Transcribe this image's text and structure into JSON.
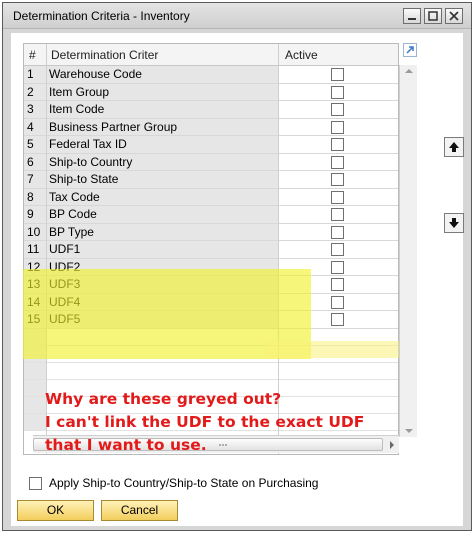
{
  "window": {
    "title": "Determination Criteria - Inventory"
  },
  "grid": {
    "headers": {
      "num": "#",
      "criteria": "Determination Criter",
      "active": "Active"
    },
    "rows": [
      {
        "num": "1",
        "name": "Warehouse Code"
      },
      {
        "num": "2",
        "name": "Item Group"
      },
      {
        "num": "3",
        "name": "Item Code"
      },
      {
        "num": "4",
        "name": "Business Partner Group"
      },
      {
        "num": "5",
        "name": "Federal Tax ID"
      },
      {
        "num": "6",
        "name": "Ship-to Country"
      },
      {
        "num": "7",
        "name": "Ship-to State"
      },
      {
        "num": "8",
        "name": "Tax Code"
      },
      {
        "num": "9",
        "name": "BP Code"
      },
      {
        "num": "10",
        "name": "BP Type"
      },
      {
        "num": "11",
        "name": "UDF1"
      },
      {
        "num": "12",
        "name": "UDF2"
      },
      {
        "num": "13",
        "name": "UDF3"
      },
      {
        "num": "14",
        "name": "UDF4"
      },
      {
        "num": "15",
        "name": "UDF5"
      }
    ]
  },
  "annotation": {
    "line1": "Why are these greyed out?",
    "line2": "I can't link the UDF to the exact UDF",
    "line3": "that I want to use."
  },
  "options": {
    "apply_ship_to": "Apply Ship-to Country/Ship-to State on Purchasing"
  },
  "buttons": {
    "ok": "OK",
    "cancel": "Cancel"
  },
  "colors": {
    "highlight": "#f0f028",
    "button": "#f2cd5c",
    "annotation": "#e21a1a"
  }
}
